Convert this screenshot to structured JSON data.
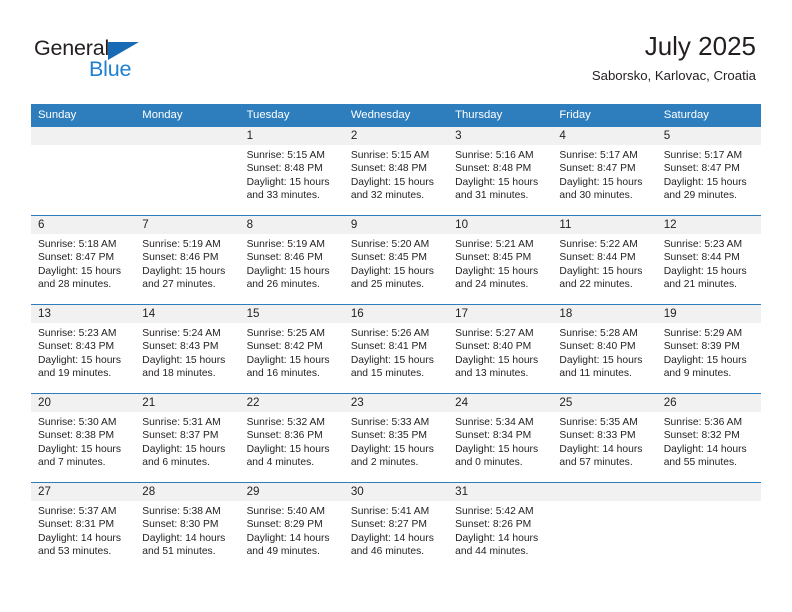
{
  "brand": {
    "name_part1": "General",
    "name_part2": "Blue",
    "color_dark": "#231f20",
    "color_blue": "#1f7fd0",
    "triangle_color": "#176bb5"
  },
  "header": {
    "month_title": "July 2025",
    "location": "Saborsko, Karlovac, Croatia",
    "header_bg": "#2e7ebd",
    "daynum_bg": "#f1f1f1"
  },
  "weekday_headers": [
    "Sunday",
    "Monday",
    "Tuesday",
    "Wednesday",
    "Thursday",
    "Friday",
    "Saturday"
  ],
  "weeks": [
    [
      {
        "day": "",
        "sunrise": "",
        "sunset": "",
        "daylight_line1": "",
        "daylight_line2": ""
      },
      {
        "day": "",
        "sunrise": "",
        "sunset": "",
        "daylight_line1": "",
        "daylight_line2": ""
      },
      {
        "day": "1",
        "sunrise": "Sunrise: 5:15 AM",
        "sunset": "Sunset: 8:48 PM",
        "daylight_line1": "Daylight: 15 hours",
        "daylight_line2": "and 33 minutes."
      },
      {
        "day": "2",
        "sunrise": "Sunrise: 5:15 AM",
        "sunset": "Sunset: 8:48 PM",
        "daylight_line1": "Daylight: 15 hours",
        "daylight_line2": "and 32 minutes."
      },
      {
        "day": "3",
        "sunrise": "Sunrise: 5:16 AM",
        "sunset": "Sunset: 8:48 PM",
        "daylight_line1": "Daylight: 15 hours",
        "daylight_line2": "and 31 minutes."
      },
      {
        "day": "4",
        "sunrise": "Sunrise: 5:17 AM",
        "sunset": "Sunset: 8:47 PM",
        "daylight_line1": "Daylight: 15 hours",
        "daylight_line2": "and 30 minutes."
      },
      {
        "day": "5",
        "sunrise": "Sunrise: 5:17 AM",
        "sunset": "Sunset: 8:47 PM",
        "daylight_line1": "Daylight: 15 hours",
        "daylight_line2": "and 29 minutes."
      }
    ],
    [
      {
        "day": "6",
        "sunrise": "Sunrise: 5:18 AM",
        "sunset": "Sunset: 8:47 PM",
        "daylight_line1": "Daylight: 15 hours",
        "daylight_line2": "and 28 minutes."
      },
      {
        "day": "7",
        "sunrise": "Sunrise: 5:19 AM",
        "sunset": "Sunset: 8:46 PM",
        "daylight_line1": "Daylight: 15 hours",
        "daylight_line2": "and 27 minutes."
      },
      {
        "day": "8",
        "sunrise": "Sunrise: 5:19 AM",
        "sunset": "Sunset: 8:46 PM",
        "daylight_line1": "Daylight: 15 hours",
        "daylight_line2": "and 26 minutes."
      },
      {
        "day": "9",
        "sunrise": "Sunrise: 5:20 AM",
        "sunset": "Sunset: 8:45 PM",
        "daylight_line1": "Daylight: 15 hours",
        "daylight_line2": "and 25 minutes."
      },
      {
        "day": "10",
        "sunrise": "Sunrise: 5:21 AM",
        "sunset": "Sunset: 8:45 PM",
        "daylight_line1": "Daylight: 15 hours",
        "daylight_line2": "and 24 minutes."
      },
      {
        "day": "11",
        "sunrise": "Sunrise: 5:22 AM",
        "sunset": "Sunset: 8:44 PM",
        "daylight_line1": "Daylight: 15 hours",
        "daylight_line2": "and 22 minutes."
      },
      {
        "day": "12",
        "sunrise": "Sunrise: 5:23 AM",
        "sunset": "Sunset: 8:44 PM",
        "daylight_line1": "Daylight: 15 hours",
        "daylight_line2": "and 21 minutes."
      }
    ],
    [
      {
        "day": "13",
        "sunrise": "Sunrise: 5:23 AM",
        "sunset": "Sunset: 8:43 PM",
        "daylight_line1": "Daylight: 15 hours",
        "daylight_line2": "and 19 minutes."
      },
      {
        "day": "14",
        "sunrise": "Sunrise: 5:24 AM",
        "sunset": "Sunset: 8:43 PM",
        "daylight_line1": "Daylight: 15 hours",
        "daylight_line2": "and 18 minutes."
      },
      {
        "day": "15",
        "sunrise": "Sunrise: 5:25 AM",
        "sunset": "Sunset: 8:42 PM",
        "daylight_line1": "Daylight: 15 hours",
        "daylight_line2": "and 16 minutes."
      },
      {
        "day": "16",
        "sunrise": "Sunrise: 5:26 AM",
        "sunset": "Sunset: 8:41 PM",
        "daylight_line1": "Daylight: 15 hours",
        "daylight_line2": "and 15 minutes."
      },
      {
        "day": "17",
        "sunrise": "Sunrise: 5:27 AM",
        "sunset": "Sunset: 8:40 PM",
        "daylight_line1": "Daylight: 15 hours",
        "daylight_line2": "and 13 minutes."
      },
      {
        "day": "18",
        "sunrise": "Sunrise: 5:28 AM",
        "sunset": "Sunset: 8:40 PM",
        "daylight_line1": "Daylight: 15 hours",
        "daylight_line2": "and 11 minutes."
      },
      {
        "day": "19",
        "sunrise": "Sunrise: 5:29 AM",
        "sunset": "Sunset: 8:39 PM",
        "daylight_line1": "Daylight: 15 hours",
        "daylight_line2": "and 9 minutes."
      }
    ],
    [
      {
        "day": "20",
        "sunrise": "Sunrise: 5:30 AM",
        "sunset": "Sunset: 8:38 PM",
        "daylight_line1": "Daylight: 15 hours",
        "daylight_line2": "and 7 minutes."
      },
      {
        "day": "21",
        "sunrise": "Sunrise: 5:31 AM",
        "sunset": "Sunset: 8:37 PM",
        "daylight_line1": "Daylight: 15 hours",
        "daylight_line2": "and 6 minutes."
      },
      {
        "day": "22",
        "sunrise": "Sunrise: 5:32 AM",
        "sunset": "Sunset: 8:36 PM",
        "daylight_line1": "Daylight: 15 hours",
        "daylight_line2": "and 4 minutes."
      },
      {
        "day": "23",
        "sunrise": "Sunrise: 5:33 AM",
        "sunset": "Sunset: 8:35 PM",
        "daylight_line1": "Daylight: 15 hours",
        "daylight_line2": "and 2 minutes."
      },
      {
        "day": "24",
        "sunrise": "Sunrise: 5:34 AM",
        "sunset": "Sunset: 8:34 PM",
        "daylight_line1": "Daylight: 15 hours",
        "daylight_line2": "and 0 minutes."
      },
      {
        "day": "25",
        "sunrise": "Sunrise: 5:35 AM",
        "sunset": "Sunset: 8:33 PM",
        "daylight_line1": "Daylight: 14 hours",
        "daylight_line2": "and 57 minutes."
      },
      {
        "day": "26",
        "sunrise": "Sunrise: 5:36 AM",
        "sunset": "Sunset: 8:32 PM",
        "daylight_line1": "Daylight: 14 hours",
        "daylight_line2": "and 55 minutes."
      }
    ],
    [
      {
        "day": "27",
        "sunrise": "Sunrise: 5:37 AM",
        "sunset": "Sunset: 8:31 PM",
        "daylight_line1": "Daylight: 14 hours",
        "daylight_line2": "and 53 minutes."
      },
      {
        "day": "28",
        "sunrise": "Sunrise: 5:38 AM",
        "sunset": "Sunset: 8:30 PM",
        "daylight_line1": "Daylight: 14 hours",
        "daylight_line2": "and 51 minutes."
      },
      {
        "day": "29",
        "sunrise": "Sunrise: 5:40 AM",
        "sunset": "Sunset: 8:29 PM",
        "daylight_line1": "Daylight: 14 hours",
        "daylight_line2": "and 49 minutes."
      },
      {
        "day": "30",
        "sunrise": "Sunrise: 5:41 AM",
        "sunset": "Sunset: 8:27 PM",
        "daylight_line1": "Daylight: 14 hours",
        "daylight_line2": "and 46 minutes."
      },
      {
        "day": "31",
        "sunrise": "Sunrise: 5:42 AM",
        "sunset": "Sunset: 8:26 PM",
        "daylight_line1": "Daylight: 14 hours",
        "daylight_line2": "and 44 minutes."
      },
      {
        "day": "",
        "sunrise": "",
        "sunset": "",
        "daylight_line1": "",
        "daylight_line2": ""
      },
      {
        "day": "",
        "sunrise": "",
        "sunset": "",
        "daylight_line1": "",
        "daylight_line2": ""
      }
    ]
  ]
}
